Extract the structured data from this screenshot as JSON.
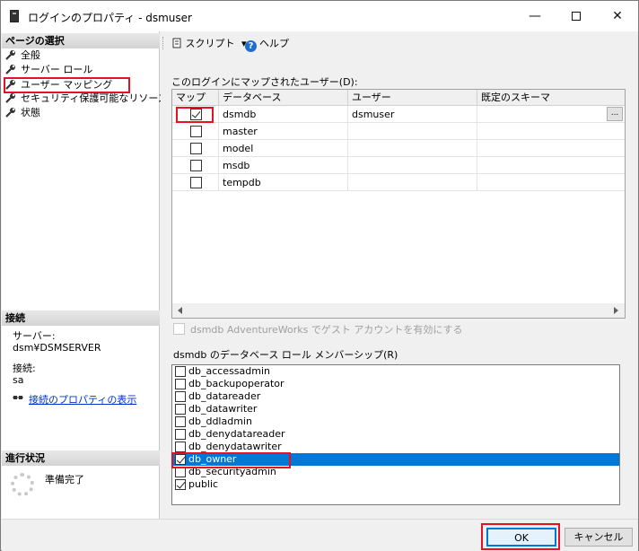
{
  "window": {
    "title": "ログインのプロパティ - dsmuser",
    "minimize": "—",
    "close": "✕"
  },
  "left": {
    "page_select_header": "ページの選択",
    "nav_items": [
      {
        "label": "全般"
      },
      {
        "label": "サーバー ロール"
      },
      {
        "label": "ユーザー マッピング"
      },
      {
        "label": "セキュリティ保護可能なリソース"
      },
      {
        "label": "状態"
      }
    ],
    "connection_header": "接続",
    "server_label": "サーバー:",
    "server_value": "dsm¥DSMSERVER",
    "connection_label": "接続:",
    "connection_value": "sa",
    "connection_link": "接続のプロパティの表示",
    "progress_header": "進行状況",
    "progress_status": "準備完了"
  },
  "toolbar": {
    "script_label": "スクリプト",
    "help_label": "ヘルプ"
  },
  "mapping": {
    "label": "このログインにマップされたユーザー(D):",
    "columns": [
      "マップ",
      "データベース",
      "ユーザー",
      "既定のスキーマ"
    ],
    "rows": [
      {
        "map": true,
        "database": "dsmdb",
        "user": "dsmuser",
        "schema": ""
      },
      {
        "map": false,
        "database": "master",
        "user": "",
        "schema": ""
      },
      {
        "map": false,
        "database": "model",
        "user": "",
        "schema": ""
      },
      {
        "map": false,
        "database": "msdb",
        "user": "",
        "schema": ""
      },
      {
        "map": false,
        "database": "tempdb",
        "user": "",
        "schema": ""
      }
    ],
    "ellipsis": "..."
  },
  "guest_account": {
    "label": "dsmdb AdventureWorks でゲスト アカウントを有効にする",
    "checked": false
  },
  "roles": {
    "label": "dsmdb のデータベース ロール メンバーシップ(R)",
    "items": [
      {
        "name": "db_accessadmin",
        "checked": false
      },
      {
        "name": "db_backupoperator",
        "checked": false
      },
      {
        "name": "db_datareader",
        "checked": false
      },
      {
        "name": "db_datawriter",
        "checked": false
      },
      {
        "name": "db_ddladmin",
        "checked": false
      },
      {
        "name": "db_denydatareader",
        "checked": false
      },
      {
        "name": "db_denydatawriter",
        "checked": false
      },
      {
        "name": "db_owner",
        "checked": true
      },
      {
        "name": "db_securityadmin",
        "checked": false
      },
      {
        "name": "public",
        "checked": true
      }
    ]
  },
  "buttons": {
    "ok": "OK",
    "cancel": "キャンセル"
  },
  "colors": {
    "highlight_red": "#e81123",
    "selection_blue": "#0078d7",
    "link_blue": "#0033cc"
  }
}
